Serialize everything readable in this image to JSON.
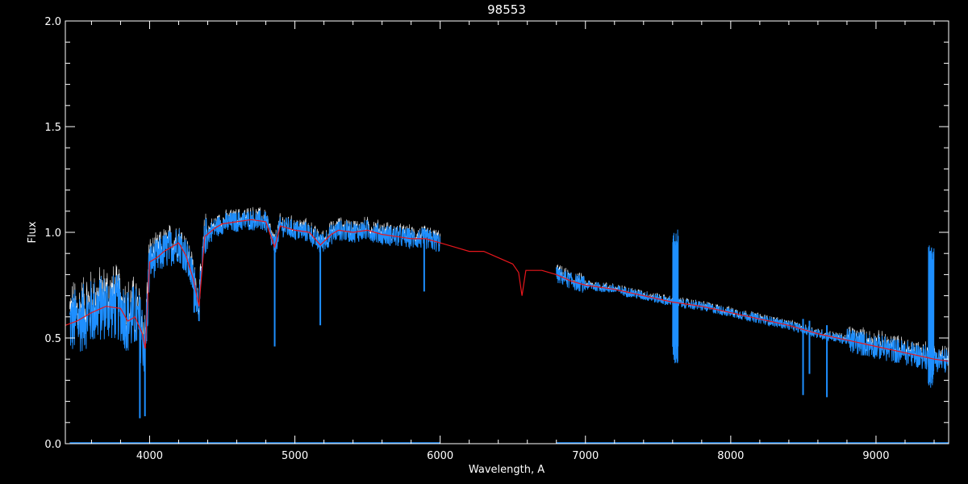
{
  "chart_data": {
    "type": "line",
    "title": "98553",
    "xlabel": "Wavelength, A",
    "ylabel": "Flux",
    "xlim": [
      3420,
      9500
    ],
    "ylim": [
      0,
      2.0
    ],
    "x_ticks": [
      4000,
      5000,
      6000,
      7000,
      8000,
      9000
    ],
    "y_ticks": [
      0.0,
      0.5,
      1.0,
      1.5,
      2.0
    ],
    "y_tick_labels": [
      "0.0",
      "0.5",
      "1.0",
      "1.5",
      "2.0"
    ],
    "grid": false,
    "legend": "none",
    "colors": {
      "background": "#000000",
      "axes": "#ffffff",
      "observed": "#1e8fff",
      "observed_envelope": "#ffffff",
      "model": "#e8161c",
      "error": "#1e8fff"
    },
    "series": [
      {
        "key": "model",
        "x": [
          3420,
          3500,
          3600,
          3700,
          3800,
          3850,
          3900,
          3950,
          3970,
          4000,
          4050,
          4100,
          4150,
          4200,
          4250,
          4300,
          4340,
          4380,
          4450,
          4500,
          4600,
          4700,
          4800,
          4861,
          4900,
          5000,
          5100,
          5175,
          5250,
          5300,
          5400,
          5500,
          5600,
          5700,
          5800,
          5900,
          6000,
          6100,
          6200,
          6300,
          6400,
          6500,
          6540,
          6563,
          6590,
          6700,
          6800,
          6900,
          7000,
          7200,
          7400,
          7600,
          7800,
          8000,
          8200,
          8400,
          8600,
          8800,
          9000,
          9200,
          9400,
          9500
        ],
        "y": [
          0.56,
          0.58,
          0.62,
          0.65,
          0.64,
          0.58,
          0.6,
          0.52,
          0.45,
          0.86,
          0.88,
          0.91,
          0.93,
          0.95,
          0.89,
          0.78,
          0.65,
          0.98,
          1.02,
          1.04,
          1.05,
          1.06,
          1.05,
          0.93,
          1.03,
          1.01,
          1.0,
          0.94,
          0.99,
          1.01,
          1.0,
          1.01,
          0.99,
          0.98,
          0.97,
          0.97,
          0.95,
          0.93,
          0.91,
          0.91,
          0.88,
          0.85,
          0.81,
          0.7,
          0.82,
          0.82,
          0.8,
          0.77,
          0.75,
          0.73,
          0.7,
          0.67,
          0.65,
          0.62,
          0.59,
          0.56,
          0.52,
          0.49,
          0.46,
          0.43,
          0.4,
          0.39
        ]
      },
      {
        "key": "observed",
        "x_ranges": [
          [
            3450,
            6000
          ],
          [
            6800,
            9500
          ]
        ],
        "typical_y": [
          0.55,
          0.75,
          1.0,
          1.05,
          1.03,
          0.98,
          0.8,
          0.65,
          0.55,
          0.45
        ],
        "absorption_lines": [
          {
            "x": 3933,
            "y": 0.12
          },
          {
            "x": 3968,
            "y": 0.13
          },
          {
            "x": 4307,
            "y": 0.62
          },
          {
            "x": 4861,
            "y": 0.46
          },
          {
            "x": 5175,
            "y": 0.56
          },
          {
            "x": 5890,
            "y": 0.72
          },
          {
            "x": 8498,
            "y": 0.23
          },
          {
            "x": 8542,
            "y": 0.33
          },
          {
            "x": 8662,
            "y": 0.22
          }
        ],
        "noise_features": [
          {
            "x": 7620,
            "y_min": 0.38,
            "y_max": 1.02
          },
          {
            "x": 9380,
            "y_min": 0.26,
            "y_max": 0.94
          }
        ]
      },
      {
        "key": "error",
        "x_ranges": [
          [
            3450,
            6000
          ],
          [
            6800,
            9500
          ]
        ],
        "y": 0.0
      }
    ]
  }
}
